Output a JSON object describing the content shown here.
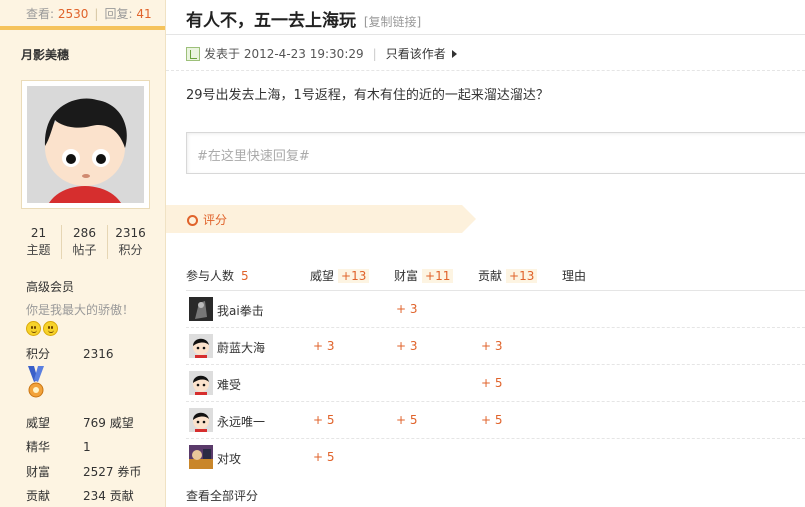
{
  "sidebar": {
    "views_label": "查看:",
    "views_value": "2530",
    "replies_label": "回复:",
    "replies_value": "41",
    "username": "月影美穗",
    "stats": [
      {
        "value": "21",
        "label": "主题"
      },
      {
        "value": "286",
        "label": "帖子"
      },
      {
        "value": "2316",
        "label": "积分"
      }
    ],
    "group": "高级会员",
    "motto": "你是我最大的骄傲！",
    "points": {
      "label": "积分",
      "value": "2316"
    },
    "details": [
      {
        "label": "威望",
        "value": "769 威望"
      },
      {
        "label": "精华",
        "value": "1"
      },
      {
        "label": "财富",
        "value": "2527 券币"
      },
      {
        "label": "贡献",
        "value": "234 贡献"
      }
    ]
  },
  "post": {
    "title": "有人不，五一去上海玩",
    "copy_link": "[复制链接]",
    "posted": "发表于 2012-4-23 19:30:29",
    "author_only": "只看该作者",
    "body": "29号出发去上海，1号返程，有木有住的近的一起来溜达溜达？",
    "quick_reply_placeholder": "#在这里快速回复#"
  },
  "rating": {
    "title": "评分",
    "headers": {
      "participants": "参与人数",
      "participants_count": "5",
      "prestige": "威望",
      "prestige_total": "+13",
      "wealth": "财富",
      "wealth_total": "+11",
      "contrib": "贡献",
      "contrib_total": "+13",
      "reason": "理由"
    },
    "rows": [
      {
        "name": "我ai拳击",
        "prestige": "",
        "wealth": "+ 3",
        "contrib": ""
      },
      {
        "name": "蔚蓝大海",
        "prestige": "+ 3",
        "wealth": "+ 3",
        "contrib": "+ 3"
      },
      {
        "name": "难受",
        "prestige": "",
        "wealth": "",
        "contrib": "+ 5"
      },
      {
        "name": "永远唯一",
        "prestige": "+ 5",
        "wealth": "+ 5",
        "contrib": "+ 5"
      },
      {
        "name": "对攻",
        "prestige": "+ 5",
        "wealth": "",
        "contrib": ""
      }
    ],
    "view_all": "查看全部评分"
  },
  "colors": {
    "accent": "#e0632b",
    "sidebar_bg": "#fdf4e2",
    "rate_header_bg": "#fdf1dc"
  }
}
